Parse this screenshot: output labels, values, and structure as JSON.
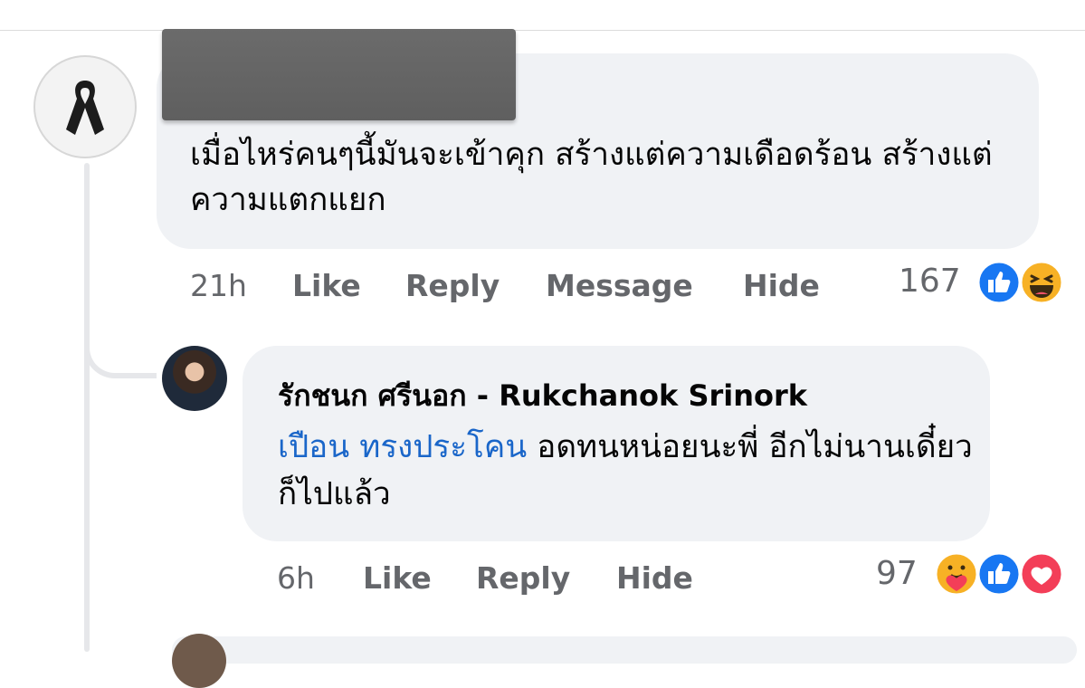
{
  "comment1": {
    "text": "เมื่อไหร่คนๆนี้มันจะเข้าคุก สร้างแต่ความเดือดร้อน สร้างแต่ความแตกแยก",
    "time": "21h",
    "actions": [
      "Like",
      "Reply",
      "Message",
      "Hide"
    ],
    "reaction_count": "167",
    "reactions": [
      "like-icon",
      "haha-icon"
    ]
  },
  "comment2": {
    "author": "รักชนก ศรีนอก - Rukchanok Srinork",
    "mention": "เปือน ทรงประโคน",
    "text": " อดทนหน่อยนะพี่ อีกไม่นานเดี๋ยวก็ไปแล้ว",
    "time": "6h",
    "actions": [
      "Like",
      "Reply",
      "Hide"
    ],
    "reaction_count": "97",
    "reactions": [
      "care-icon",
      "like-icon",
      "love-icon"
    ]
  },
  "colors": {
    "bubble": "#f0f2f5",
    "action_text": "#65676b",
    "mention": "#1a66c9",
    "like": "#1877f2",
    "love": "#f33e58"
  }
}
